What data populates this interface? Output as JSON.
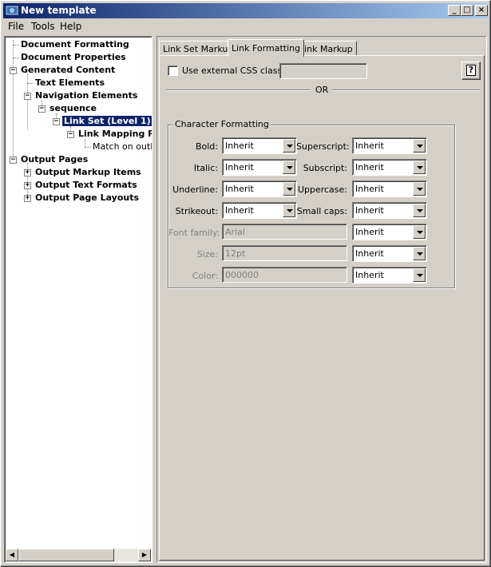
{
  "window": {
    "title": "New template",
    "controls": {
      "minimize": "_",
      "maximize": "□",
      "close": "×"
    }
  },
  "menu": [
    "File",
    "Tools",
    "Help"
  ],
  "tree": [
    {
      "label": "Document Formatting"
    },
    {
      "label": "Document Properties"
    },
    {
      "label": "Generated Content",
      "expander": "−"
    },
    {
      "label": "Text Elements"
    },
    {
      "label": "Navigation Elements",
      "expander": "−"
    },
    {
      "label": "sequence",
      "expander": "−"
    },
    {
      "label": "Link Set (Level 1)",
      "expander": "−",
      "selected": true
    },
    {
      "label": "Link Mapping Ru",
      "expander": "−"
    },
    {
      "label": "Match on outlin"
    },
    {
      "label": "Output Pages",
      "expander": "−"
    },
    {
      "label": "Output Markup Items",
      "expander": "+"
    },
    {
      "label": "Output Text Formats",
      "expander": "+"
    },
    {
      "label": "Output Page Layouts",
      "expander": "+"
    }
  ],
  "tabs": [
    {
      "label": "Link Set Markup",
      "active": false
    },
    {
      "label": "Link Formatting",
      "active": true
    },
    {
      "label": "Link Markup",
      "active": false
    }
  ],
  "form": {
    "external_css_label": "Use external CSS class:",
    "external_css_checked": false,
    "external_css_value": "",
    "or_label": "OR",
    "help_label": "?",
    "group_title": "Character Formatting",
    "left": [
      {
        "label": "Bold:",
        "value": "Inherit"
      },
      {
        "label": "Italic:",
        "value": "Inherit"
      },
      {
        "label": "Underline:",
        "value": "Inherit"
      },
      {
        "label": "Strikeout:",
        "value": "Inherit"
      }
    ],
    "right": [
      {
        "label": "Superscript:",
        "value": "Inherit"
      },
      {
        "label": "Subscript:",
        "value": "Inherit"
      },
      {
        "label": "Uppercase:",
        "value": "Inherit"
      },
      {
        "label": "Small caps:",
        "value": "Inherit"
      }
    ],
    "font_family": {
      "label": "Font family:",
      "value": "Arial",
      "mode": "Inherit"
    },
    "size": {
      "label": "Size:",
      "value": "12pt",
      "mode": "Inherit"
    },
    "color": {
      "label": "Color:",
      "value": "000000",
      "mode": "Inherit"
    }
  }
}
